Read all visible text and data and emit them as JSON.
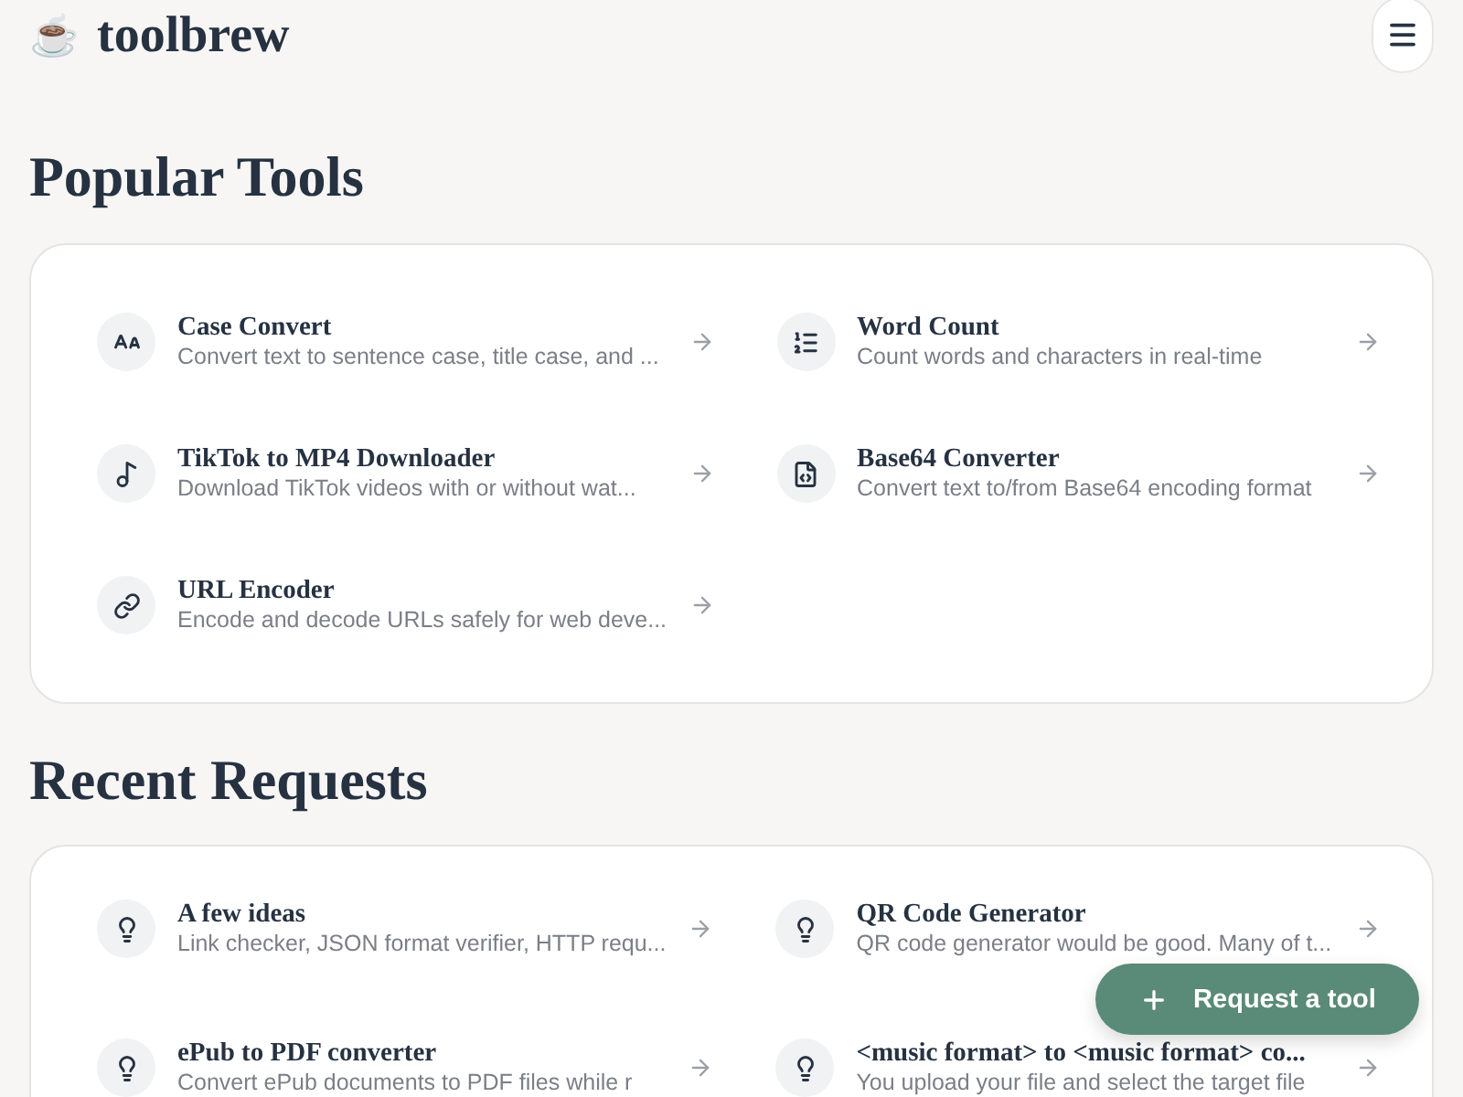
{
  "header": {
    "logo_emoji": "☕",
    "brand": "toolbrew"
  },
  "sections": [
    {
      "title": "Popular Tools",
      "items": [
        {
          "kind": "case",
          "title": "Case Convert",
          "description": "Convert text to sentence case, title case, and ..."
        },
        {
          "kind": "list",
          "title": "Word Count",
          "description": "Count words and characters in real-time"
        },
        {
          "kind": "music",
          "title": "TikTok to MP4 Downloader",
          "description": "Download TikTok videos with or without wat..."
        },
        {
          "kind": "file-code",
          "title": "Base64 Converter",
          "description": "Convert text to/from Base64 encoding format"
        },
        {
          "kind": "link",
          "title": "URL Encoder",
          "description": "Encode and decode URLs safely for web deve..."
        }
      ]
    },
    {
      "title": "Recent Requests",
      "items": [
        {
          "kind": "bulb",
          "title": "A few ideas",
          "description": "Link checker, JSON format verifier, HTTP requ..."
        },
        {
          "kind": "bulb",
          "title": "QR Code Generator",
          "description": "QR code generator would be good. Many of t..."
        },
        {
          "kind": "bulb",
          "title": "ePub to PDF converter",
          "description": "Convert ePub documents to PDF files while r"
        },
        {
          "kind": "bulb",
          "title": "<music format> to <music format> co...",
          "description": "You upload your file and select the target file"
        }
      ]
    }
  ],
  "fab": {
    "label": "Request a tool"
  }
}
